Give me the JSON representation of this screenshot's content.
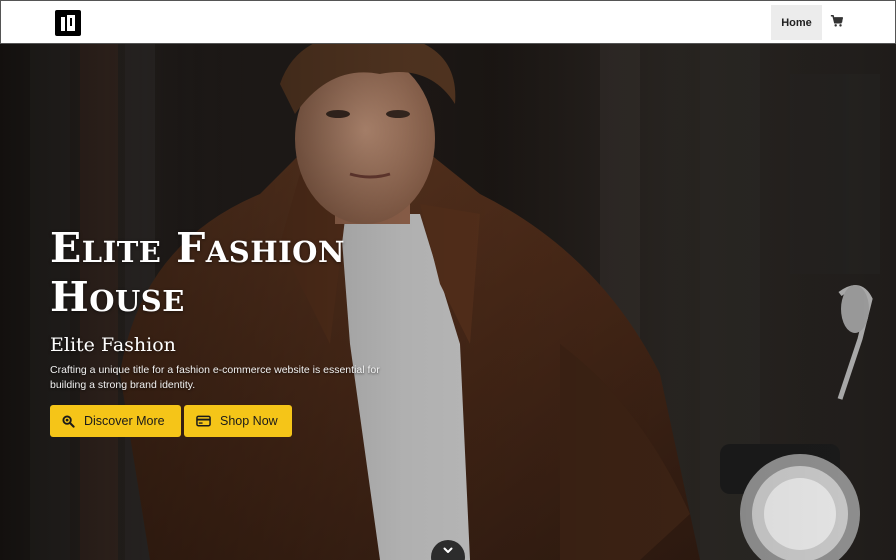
{
  "navbar": {
    "logo_icon": "logo-icon",
    "home_label": "Home",
    "cart_icon": "cart-icon"
  },
  "hero": {
    "title": "Elite Fashion House",
    "subtitle": "Elite Fashion",
    "description": "Crafting a unique title for a fashion e-commerce website is essential for building a strong brand identity.",
    "buttons": [
      {
        "label": "Discover More",
        "icon": "search-icon"
      },
      {
        "label": "Shop Now",
        "icon": "credit-card-icon"
      }
    ],
    "scroll_icon": "chevron-down-icon",
    "accent_color": "#f5c518"
  }
}
